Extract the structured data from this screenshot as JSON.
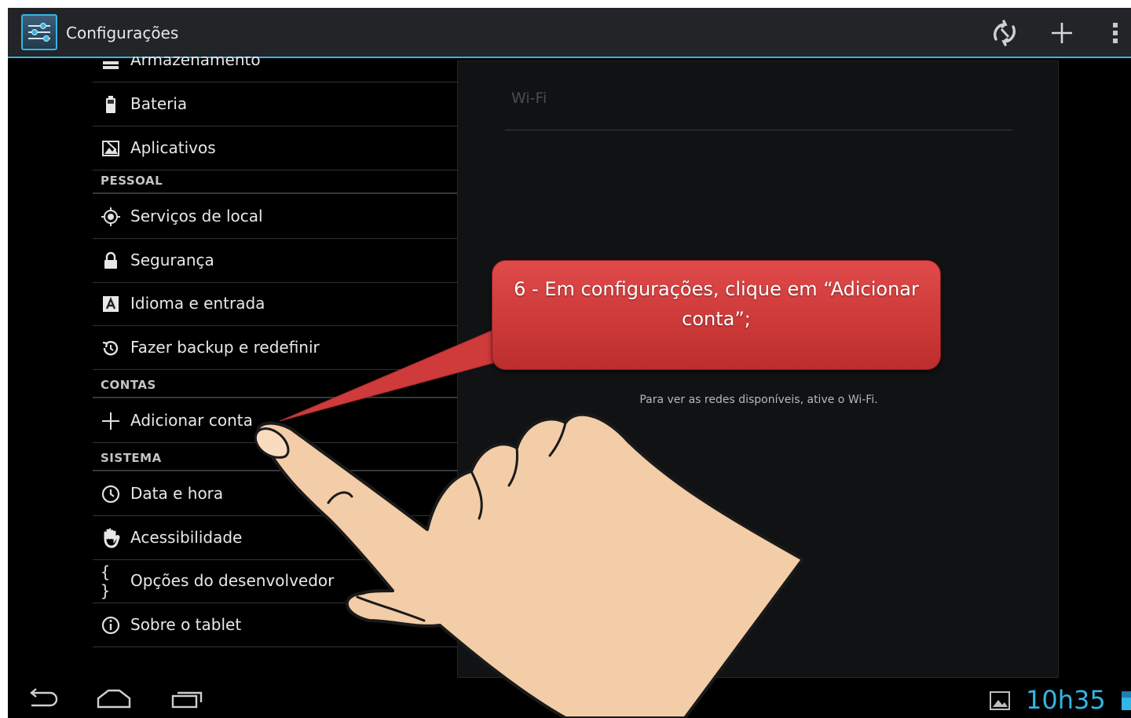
{
  "action_bar": {
    "title": "Configurações",
    "icons": [
      "settings-app-icon",
      "sync-icon",
      "add-icon",
      "overflow-menu-icon"
    ]
  },
  "settings_list": {
    "items_top": [
      {
        "label": "Armazenamento",
        "icon": "storage-icon"
      },
      {
        "label": "Bateria",
        "icon": "battery-icon"
      },
      {
        "label": "Aplicativos",
        "icon": "apps-icon"
      }
    ],
    "pessoal_header": "PESSOAL",
    "pessoal_items": [
      {
        "label": "Serviços de local",
        "icon": "location-icon"
      },
      {
        "label": "Segurança",
        "icon": "lock-icon"
      },
      {
        "label": "Idioma e entrada",
        "icon": "language-icon"
      },
      {
        "label": "Fazer backup e redefinir",
        "icon": "backup-icon"
      }
    ],
    "contas_header": "CONTAS",
    "contas_items": [
      {
        "label": "Adicionar conta",
        "icon": "plus-icon"
      }
    ],
    "sistema_header": "SISTEMA",
    "sistema_items": [
      {
        "label": "Data e hora",
        "icon": "clock-icon"
      },
      {
        "label": "Acessibilidade",
        "icon": "hand-icon"
      },
      {
        "label": "Opções do desenvolvedor",
        "icon": "braces-icon"
      },
      {
        "label": "Sobre o tablet",
        "icon": "info-icon"
      }
    ]
  },
  "wifi_pane": {
    "title": "Wi-Fi",
    "message": "Para ver as redes disponíveis, ative o Wi-Fi."
  },
  "nav_bar": {
    "buttons": [
      "back-icon",
      "home-icon",
      "recent-apps-icon"
    ],
    "clock": "10h35",
    "status_icons": [
      "gallery-notification-icon",
      "battery-status-icon"
    ]
  },
  "tutorial_callout": {
    "text": "6 - Em configurações, clique em “Adicionar conta”;"
  },
  "colors": {
    "accent": "#33b5e5",
    "callout_red": "#d13b3b",
    "hand_skin": "#f3cda8",
    "background": "#000000"
  }
}
